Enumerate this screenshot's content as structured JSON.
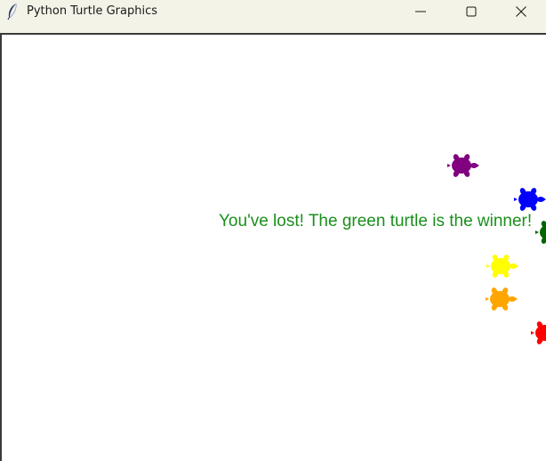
{
  "window": {
    "title": "Python Turtle Graphics",
    "icon": "feather-icon",
    "controls": {
      "minimize": "minimize-icon",
      "maximize": "maximize-icon",
      "close": "close-icon"
    }
  },
  "canvas": {
    "message": "You've lost! The green turtle is the winner!",
    "message_color": "#1b8f1b",
    "turtles": [
      {
        "name": "purple",
        "color": "#800080"
      },
      {
        "name": "blue",
        "color": "#0000ff"
      },
      {
        "name": "green",
        "color": "#006400"
      },
      {
        "name": "yellow",
        "color": "#ffff00"
      },
      {
        "name": "orange",
        "color": "#ffa500"
      },
      {
        "name": "red",
        "color": "#ff0000"
      }
    ]
  }
}
